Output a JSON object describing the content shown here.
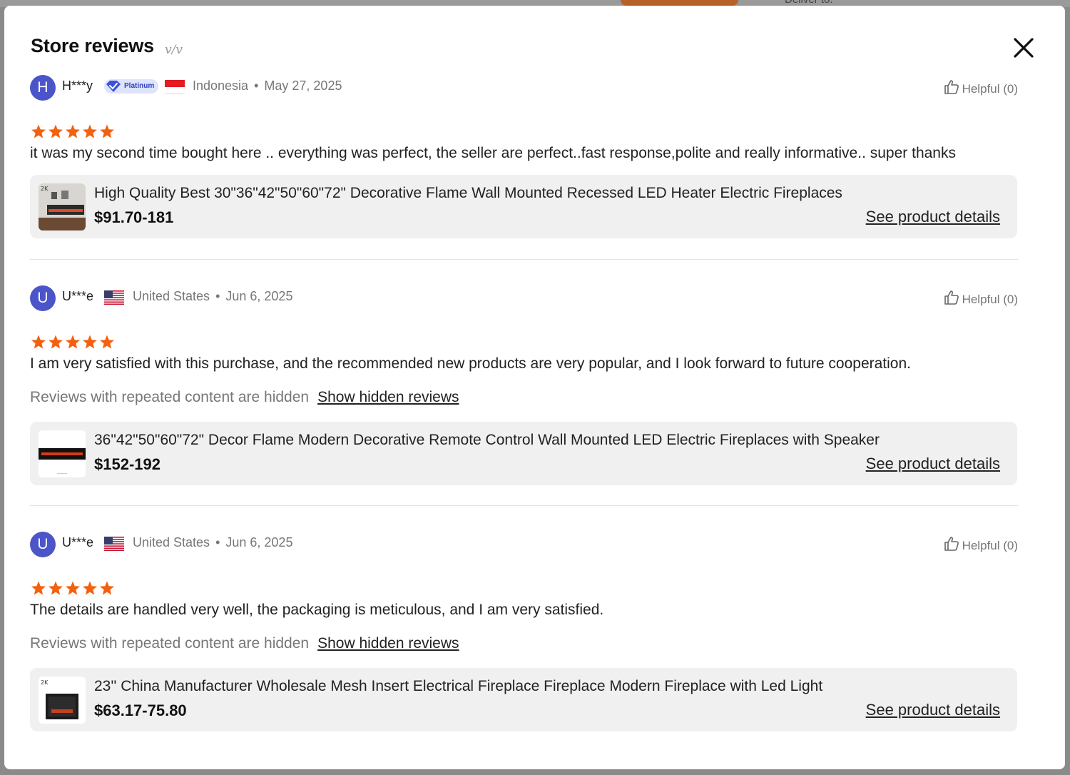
{
  "modal": {
    "title": "Store reviews",
    "title_deco": "v/v"
  },
  "reviews": [
    {
      "avatar_letter": "H",
      "user": "H***y",
      "badge": "Platinum",
      "country": "Indonesia",
      "date": "May 27, 2025",
      "helpful": "Helpful (0)",
      "rating": 5,
      "text": "it was my second time bought here .. everything was perfect, the seller are perfect..fast response,polite and really informative.. super thanks",
      "product": {
        "name": "High Quality Best 30\"36\"42\"50\"60\"72\" Decorative Flame Wall Mounted Recessed LED Heater Electric Fireplaces",
        "price": "$91.70-181",
        "link": "See product details"
      }
    },
    {
      "avatar_letter": "U",
      "user": "U***e",
      "country": "United States",
      "date": "Jun 6, 2025",
      "helpful": "Helpful (0)",
      "rating": 5,
      "text": "I am very satisfied with this purchase, and the recommended new products are very popular, and I look forward to future cooperation.",
      "hidden_note": "Reviews with repeated content are hidden",
      "hidden_link": "Show hidden reviews",
      "product": {
        "name": "36\"42\"50\"60\"72\" Decor Flame Modern Decorative Remote Control Wall Mounted LED Electric Fireplaces with Speaker",
        "price": "$152-192",
        "link": "See product details"
      }
    },
    {
      "avatar_letter": "U",
      "user": "U***e",
      "country": "United States",
      "date": "Jun 6, 2025",
      "helpful": "Helpful (0)",
      "rating": 5,
      "text": "The details are handled very well, the packaging is meticulous, and I am very satisfied.",
      "hidden_note": "Reviews with repeated content are hidden",
      "hidden_link": "Show hidden reviews",
      "product": {
        "name": "23'' China Manufacturer Wholesale Mesh Insert Electrical Fireplace Fireplace Modern Fireplace with Led Light",
        "price": "$63.17-75.80",
        "link": "See product details"
      }
    }
  ],
  "backdrop": {
    "deliver": "Deliver to:"
  },
  "colors": {
    "star": "#f3600e",
    "avatar": "#4b55c9",
    "badge_bg": "#dde4fb",
    "card_bg": "#f0f0f0"
  }
}
